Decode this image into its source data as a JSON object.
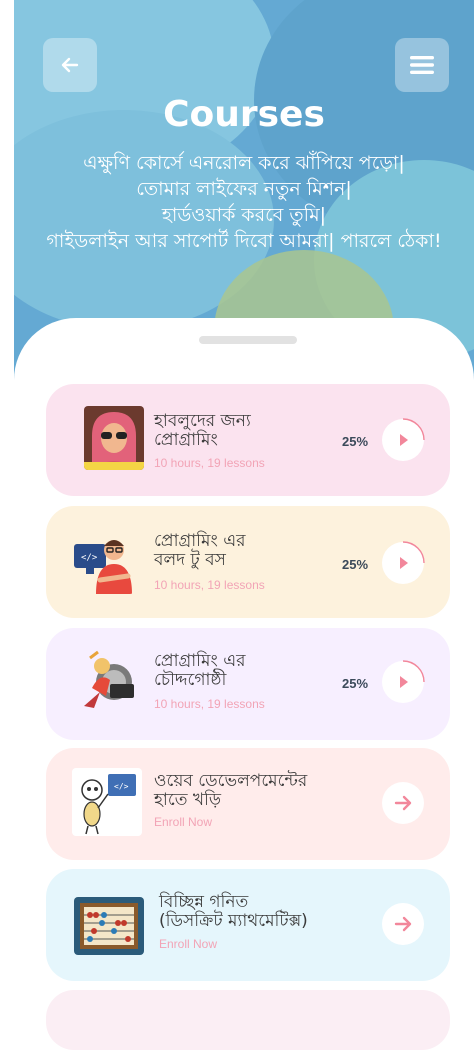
{
  "header": {
    "back_icon": "arrow-left-icon",
    "menu_icon": "hamburger-menu-icon",
    "title": "Courses",
    "tagline": [
      "এক্ষুণি কোর্সে এনরোল করে ঝাঁপিয়ে পড়ো|",
      "তোমার লাইফের নতুন মিশন|",
      "হার্ডওয়ার্ক করবে তুমি|",
      "গাইডলাইন আর সাপোর্ট দিবো আমরা| পারলে ঠেকা!"
    ]
  },
  "courses": [
    {
      "title_line1": "হাবলুদের জন্য",
      "title_line2": "প্রোগ্রামিং",
      "meta": "10 hours, 19 lessons",
      "progress_label": "25%",
      "progress": 0.25,
      "action_icon": "play-icon",
      "thumb_icon": "girl-with-glasses-illustration"
    },
    {
      "title_line1": "প্রোগ্রামিং এর",
      "title_line2": "বলদ টু বস",
      "meta": "10 hours, 19 lessons",
      "progress_label": "25%",
      "progress": 0.25,
      "action_icon": "play-icon",
      "thumb_icon": "programmer-at-monitor-illustration"
    },
    {
      "title_line1": "প্রোগ্রামিং এর",
      "title_line2": "চৌদ্দগোষ্ঠী",
      "meta": "10 hours, 19 lessons",
      "progress_label": "25%",
      "progress": 0.25,
      "action_icon": "play-icon",
      "thumb_icon": "tired-programmer-illustration"
    },
    {
      "title_line1": "ওয়েব ডেভেলপমেন্টের",
      "title_line2": "হাতে খড়ি",
      "meta": "Enroll Now",
      "action_icon": "arrow-right-icon",
      "thumb_icon": "stick-figure-code-illustration"
    },
    {
      "title_line1": "বিচ্ছিন্ন গনিত",
      "title_line2": "(ডিসক্রিট ম্যাথমেটিক্স)",
      "meta": "Enroll Now",
      "action_icon": "arrow-right-icon",
      "thumb_icon": "abacus-illustration"
    }
  ],
  "colors": {
    "hero_bg": "#64a9d3",
    "card_pink": "#fbe3ef",
    "card_cream": "#fdf2dd",
    "card_lavender": "#f7efff",
    "card_peach": "#ffeceb",
    "card_sky": "#e5f6fc",
    "accent": "#f2879b",
    "meta_text": "#f2a4b6"
  }
}
